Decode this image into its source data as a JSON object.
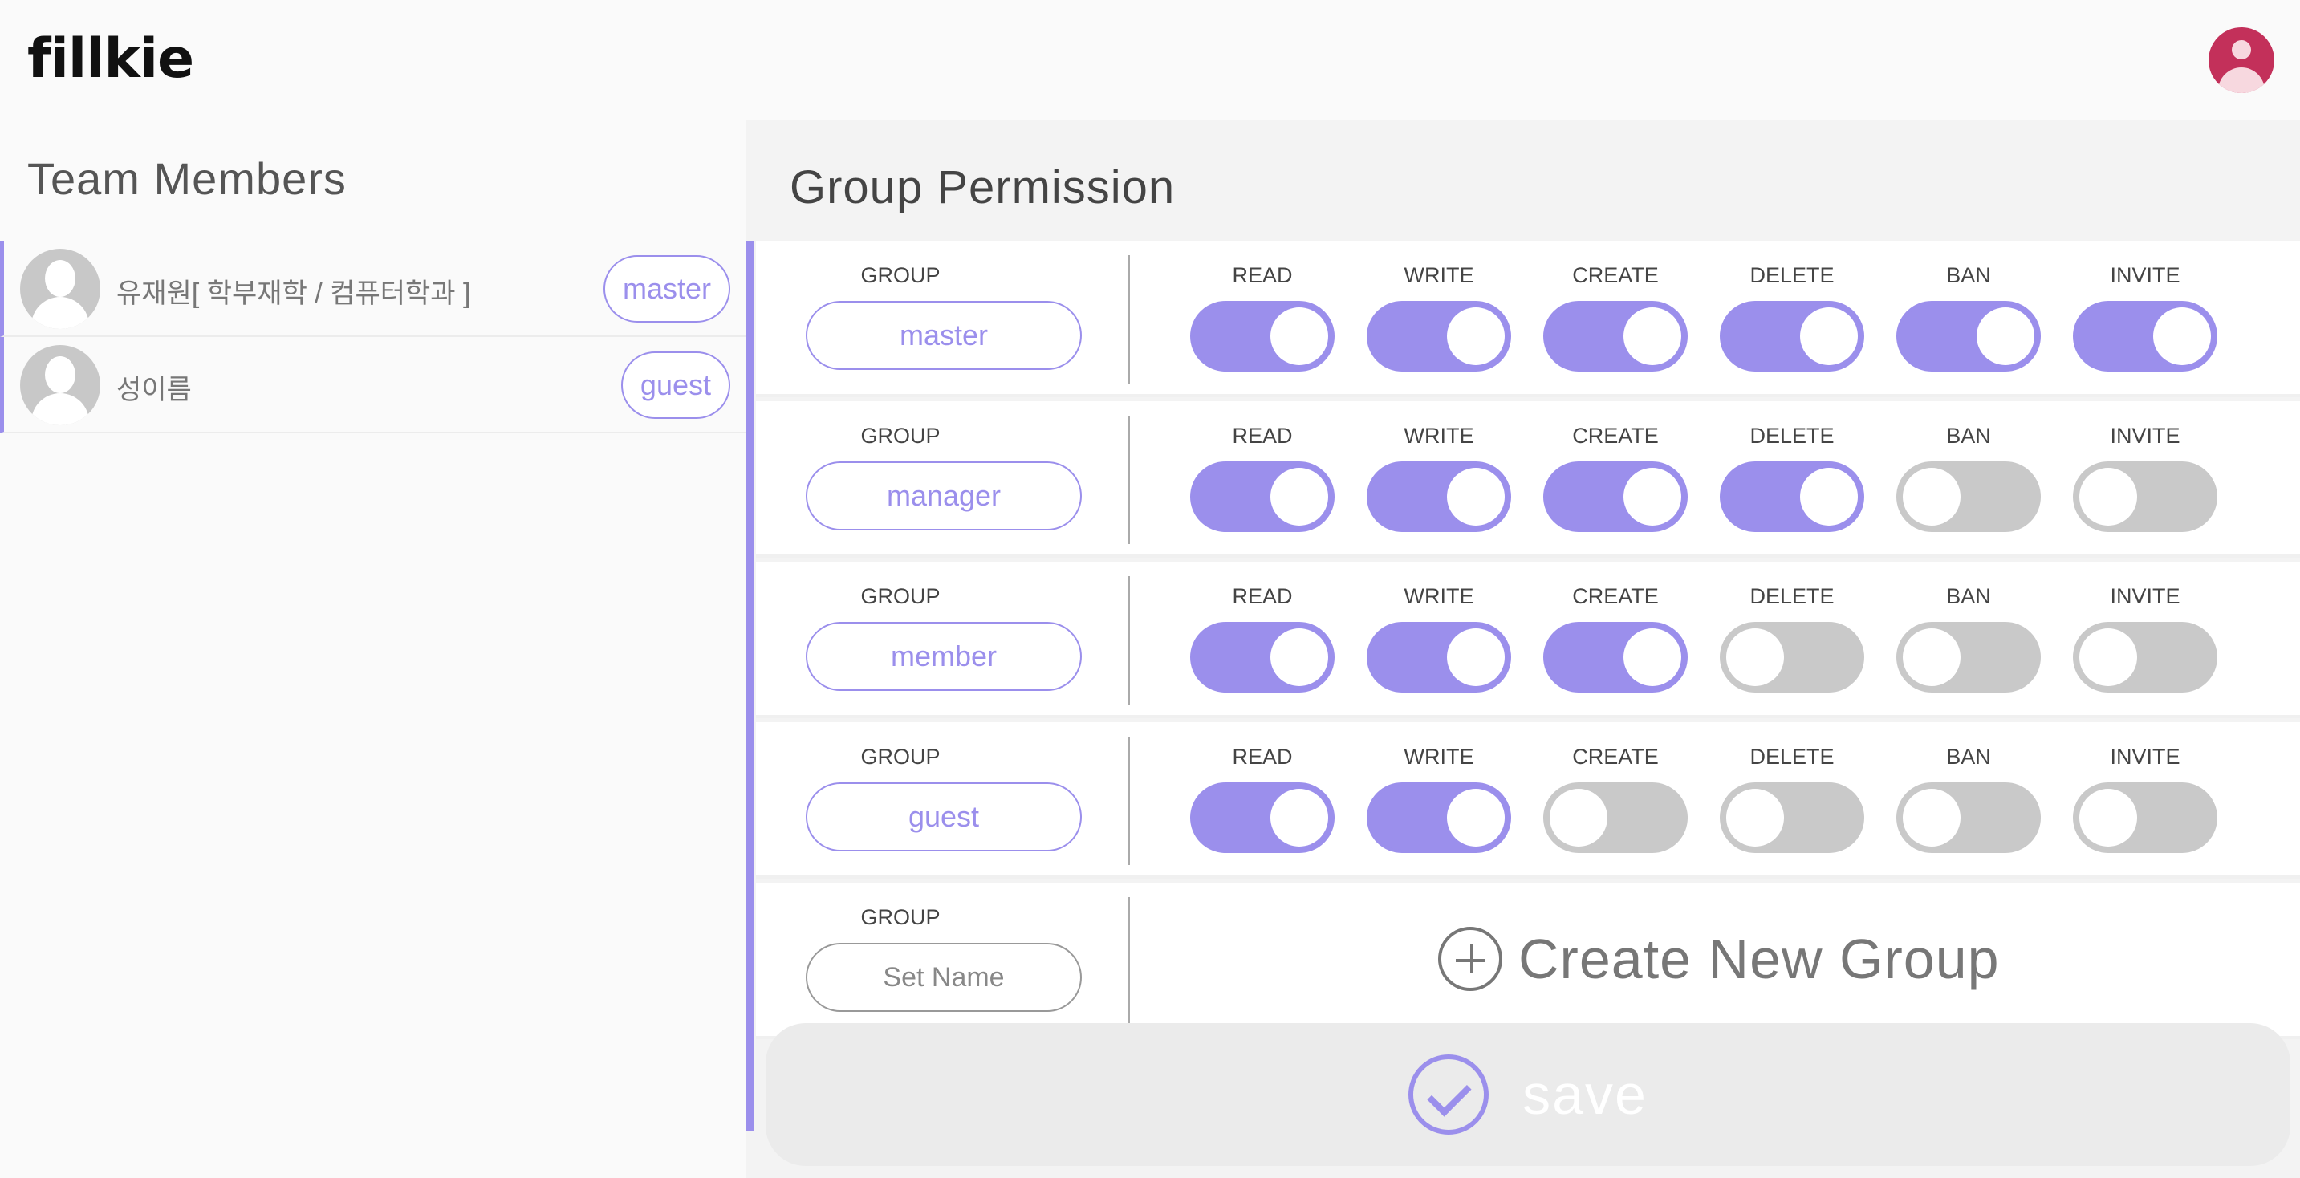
{
  "header": {
    "logo": "fillkie"
  },
  "team": {
    "title": "Team Members",
    "members": [
      {
        "name": "유재원[ 학부재학 / 컴퓨터학과 ]",
        "role": "master"
      },
      {
        "name": "성이름",
        "role": "guest"
      }
    ]
  },
  "permissions": {
    "title": "Group Permission",
    "group_label": "GROUP",
    "columns": [
      "READ",
      "WRITE",
      "CREATE",
      "DELETE",
      "BAN",
      "INVITE"
    ],
    "groups": [
      {
        "name": "master",
        "toggles": [
          true,
          true,
          true,
          true,
          true,
          true
        ]
      },
      {
        "name": "manager",
        "toggles": [
          true,
          true,
          true,
          true,
          false,
          false
        ]
      },
      {
        "name": "member",
        "toggles": [
          true,
          true,
          true,
          false,
          false,
          false
        ]
      },
      {
        "name": "guest",
        "toggles": [
          true,
          true,
          false,
          false,
          false,
          false
        ]
      }
    ],
    "new_group": {
      "placeholder": "Set Name",
      "create_label": "Create New Group"
    }
  },
  "actions": {
    "save_label": "save"
  },
  "colors": {
    "accent": "#9b8fec",
    "toggle_off": "#c9c9c9",
    "avatar": "#c3305a"
  },
  "icons": {
    "create": "plus-circle-icon",
    "save": "check-circle-icon",
    "profile": "user-avatar-icon"
  }
}
